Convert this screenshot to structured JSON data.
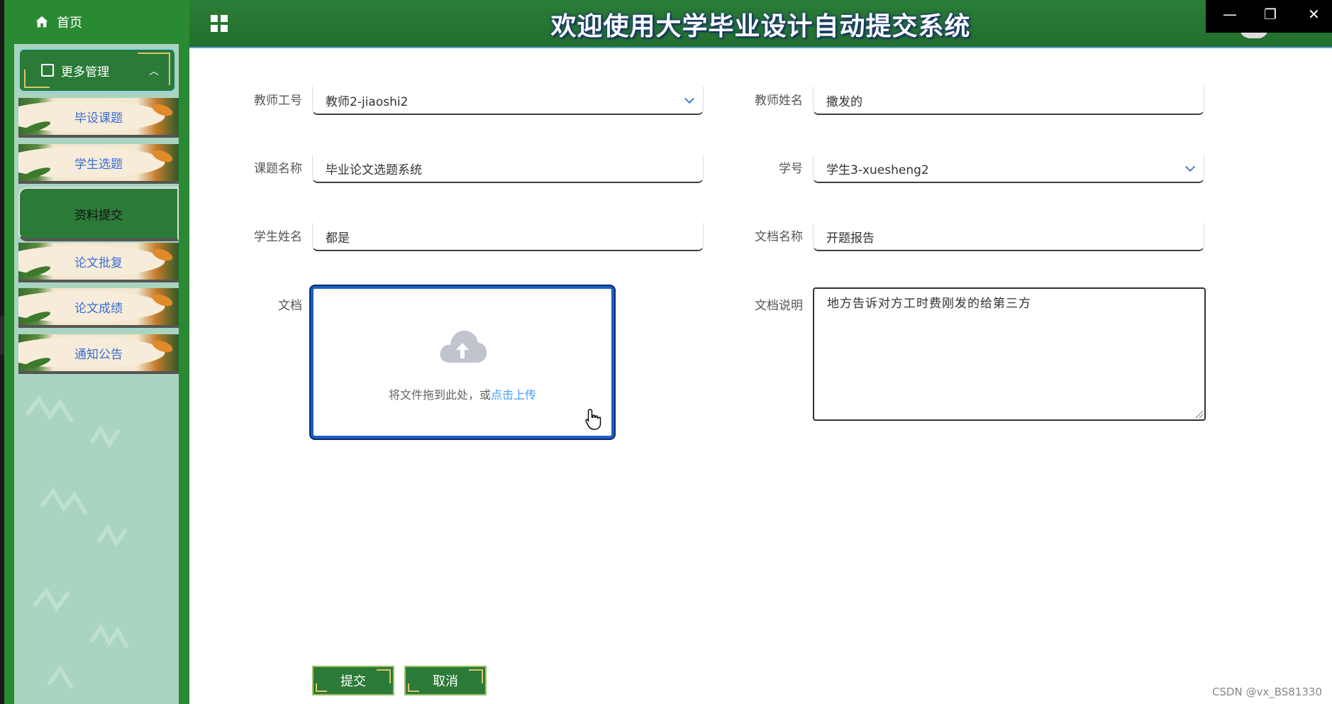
{
  "header": {
    "title": "欢迎使用大学毕业设计自动提交系统",
    "window_controls": [
      "—",
      "❐",
      "✕"
    ]
  },
  "sidebar": {
    "home_label": "首页",
    "parent_label": "更多管理",
    "items": [
      {
        "label": "毕设课题"
      },
      {
        "label": "学生选题"
      },
      {
        "label": "资料提交"
      },
      {
        "label": "论文批复"
      },
      {
        "label": "论文成绩"
      },
      {
        "label": "通知公告"
      }
    ]
  },
  "form": {
    "teacher_id": {
      "label": "教师工号",
      "value": "教师2-jiaoshi2"
    },
    "teacher_name": {
      "label": "教师姓名",
      "value": "撒发的"
    },
    "topic_name": {
      "label": "课题名称",
      "value": "毕业论文选题系统"
    },
    "student_id": {
      "label": "学号",
      "value": "学生3-xuesheng2"
    },
    "student_name": {
      "label": "学生姓名",
      "value": "都是"
    },
    "doc_name": {
      "label": "文档名称",
      "value": "开题报告"
    },
    "doc_file": {
      "label": "文档",
      "upload_text": "将文件拖到此处，或",
      "upload_link": "点击上传"
    },
    "doc_desc": {
      "label": "文档说明",
      "value": "地方告诉对方工时费刚发的给第三方"
    }
  },
  "buttons": {
    "submit": "提交",
    "cancel": "取消"
  },
  "watermark": "CSDN @vx_BS81330",
  "colors": {
    "sidebar_green": "#2a8a33",
    "header_green": "#236e2e",
    "panel_mint": "#a9d4c0",
    "link_blue": "#409eff",
    "upload_border": "#1a5fc4"
  },
  "icons": [
    "home-icon",
    "grid-icon",
    "box-icon",
    "chevron-up-icon",
    "chevron-down-icon",
    "upload-cloud-icon",
    "hand-cursor-icon",
    "resize-grip-icon"
  ]
}
